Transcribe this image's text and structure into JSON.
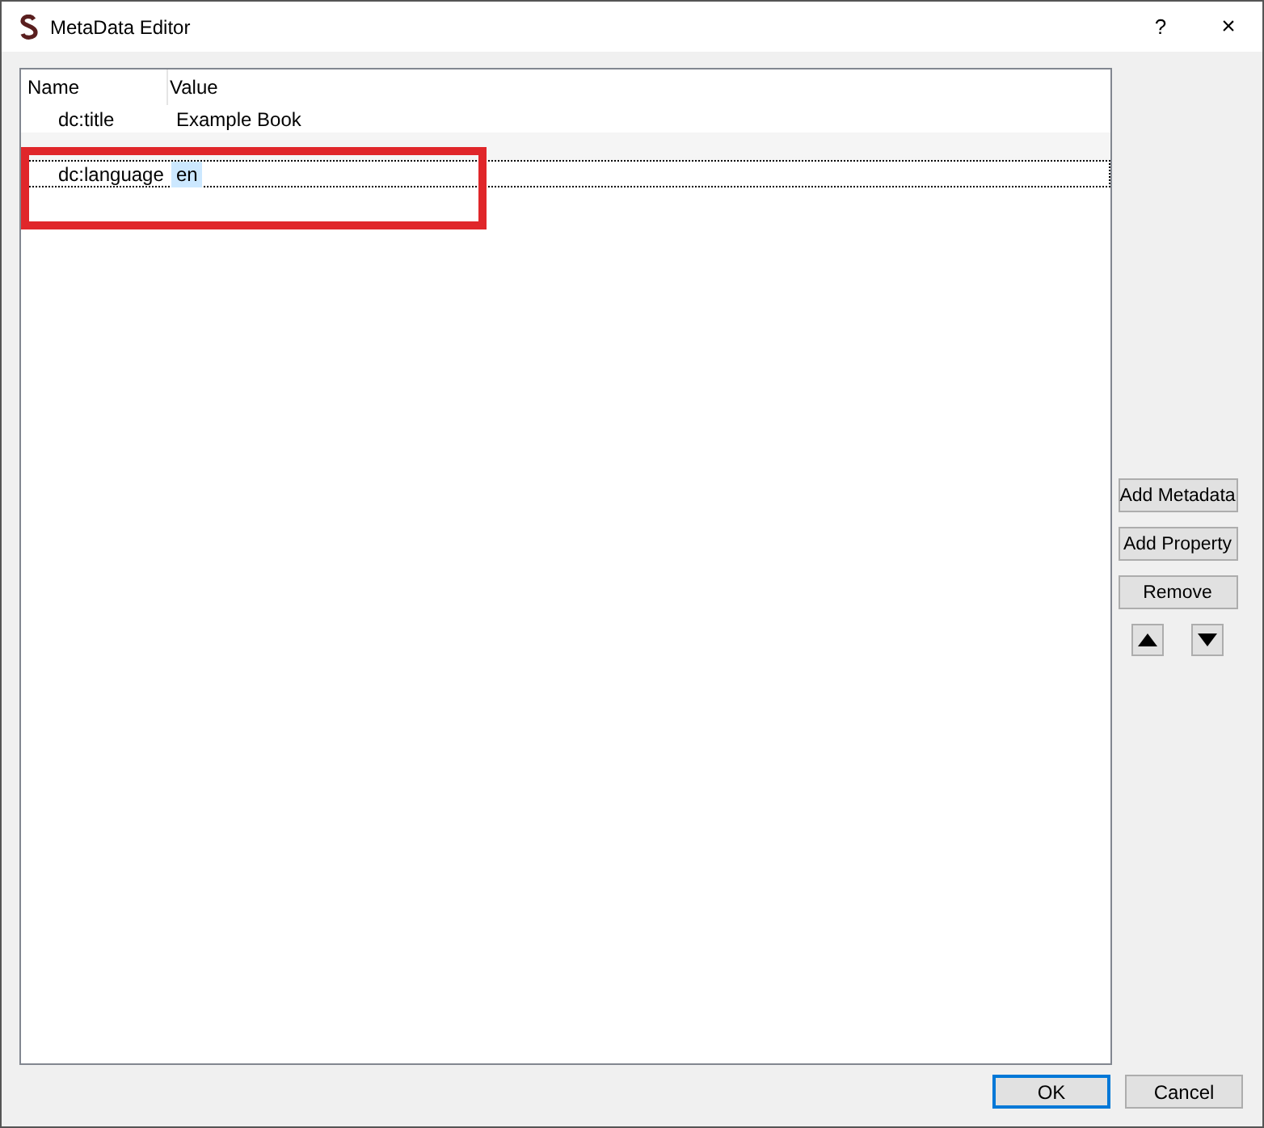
{
  "window": {
    "title": "MetaData Editor",
    "help": "?",
    "close": "×"
  },
  "table": {
    "columns": [
      "Name",
      "Value"
    ],
    "rows": [
      {
        "name": "dc:title",
        "value": "Example Book",
        "selected": false
      },
      {
        "selected": false
      },
      {
        "name": "dc:language",
        "value": "en",
        "selected": true
      }
    ]
  },
  "side_buttons": [
    "Add Metadata",
    "Add Property",
    "Remove"
  ],
  "buttons": [
    {
      "label": "OK",
      "default": true
    },
    {
      "label": "Cancel",
      "default": false
    }
  ]
}
